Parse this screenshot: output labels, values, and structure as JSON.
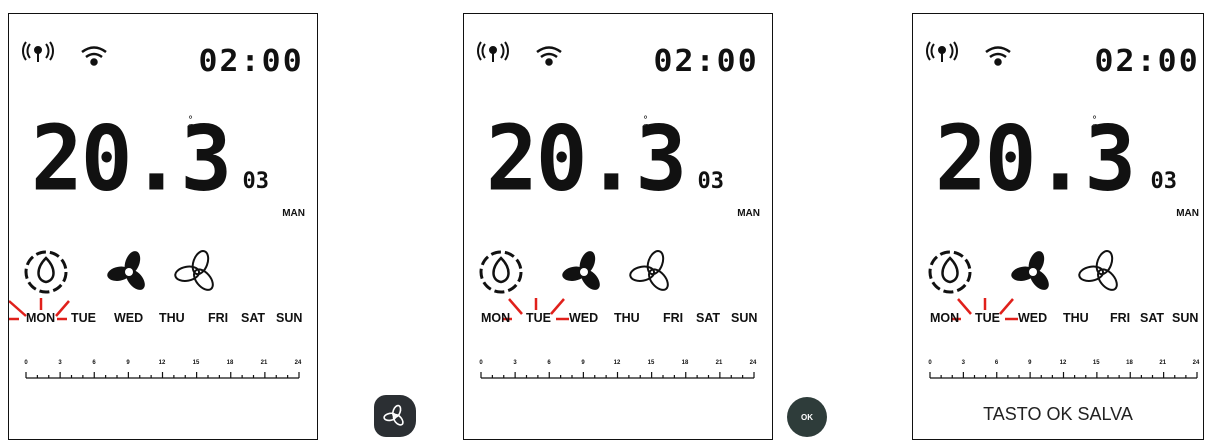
{
  "panels": [
    {
      "clock": "02:00",
      "temperature": "20.3",
      "unit": "°C",
      "set_number": "03",
      "mode": "MAN",
      "days": [
        "MON",
        "TUE",
        "WED",
        "THU",
        "FRI",
        "SAT",
        "SUN"
      ],
      "highlight_day": "MON",
      "caption": ""
    },
    {
      "clock": "02:00",
      "temperature": "20.3",
      "unit": "°C",
      "set_number": "03",
      "mode": "MAN",
      "days": [
        "MON",
        "TUE",
        "WED",
        "THU",
        "FRI",
        "SAT",
        "SUN"
      ],
      "highlight_day": "TUE",
      "caption": ""
    },
    {
      "clock": "02:00",
      "temperature": "20.3",
      "unit": "°C",
      "set_number": "03",
      "mode": "MAN",
      "days": [
        "MON",
        "TUE",
        "WED",
        "THU",
        "FRI",
        "SAT",
        "SUN"
      ],
      "highlight_day": "TUE",
      "caption": "TASTO OK SALVA"
    }
  ],
  "timeline_ticks": [
    "0",
    "3",
    "6",
    "9",
    "12",
    "15",
    "18",
    "21",
    "24"
  ],
  "buttons": {
    "fan_icon": "fan-icon",
    "ok_label": "OK"
  },
  "colors": {
    "highlight": "#e0201b",
    "button": "#2b2f33"
  }
}
